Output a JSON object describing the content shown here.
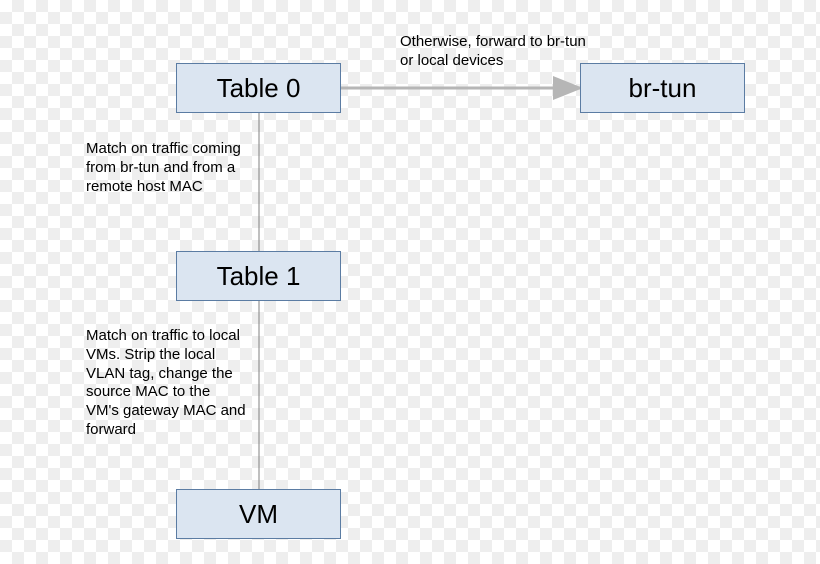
{
  "nodes": {
    "table0": "Table 0",
    "table1": "Table 1",
    "vm": "VM",
    "brtun": "br-tun"
  },
  "annotations": {
    "otherwise": "Otherwise, forward to br-tun or local devices",
    "match_brtun": "Match on traffic coming from br-tun and from a remote host MAC",
    "match_local": "Match on traffic to local VMs. Strip the local VLAN tag, change the source MAC to the VM's gateway MAC and forward"
  },
  "chart_data": {
    "type": "flow-diagram",
    "nodes": [
      {
        "id": "table0",
        "label": "Table 0"
      },
      {
        "id": "table1",
        "label": "Table 1"
      },
      {
        "id": "vm",
        "label": "VM"
      },
      {
        "id": "brtun",
        "label": "br-tun"
      }
    ],
    "edges": [
      {
        "from": "table0",
        "to": "brtun",
        "label": "Otherwise, forward to br-tun or local devices",
        "style": "arrow"
      },
      {
        "from": "table0",
        "to": "table1",
        "label": "Match on traffic coming from br-tun and from a remote host MAC",
        "style": "line"
      },
      {
        "from": "table1",
        "to": "vm",
        "label": "Match on traffic to local VMs. Strip the local VLAN tag, change the source MAC to the VM's gateway MAC and forward",
        "style": "line"
      }
    ]
  }
}
